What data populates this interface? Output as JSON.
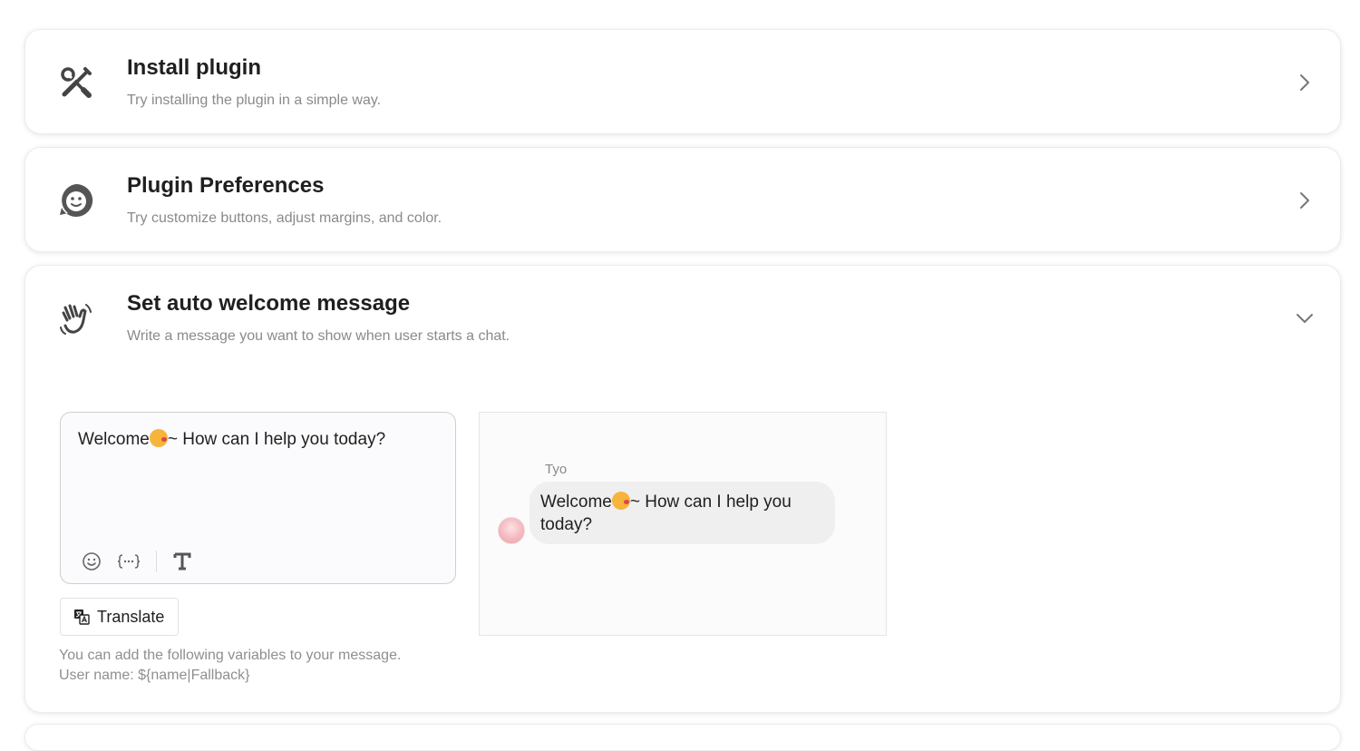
{
  "cards": [
    {
      "title": "Install plugin",
      "description": "Try installing the plugin in a simple way.",
      "icon": "tools-icon",
      "expanded": false
    },
    {
      "title": "Plugin Preferences",
      "description": "Try customize buttons, adjust margins, and color.",
      "icon": "chat-face-icon",
      "expanded": false
    },
    {
      "title": "Set auto welcome message",
      "description": "Write a message you want to show when user starts a chat.",
      "icon": "waving-hand-icon",
      "expanded": true
    }
  ],
  "welcome": {
    "message_before_emoji": "Welcome",
    "message_after_emoji": "~ How can I help you today?",
    "emoji": "kissing-face-emoji",
    "toolbar": [
      "emoji-icon",
      "variable-icon",
      "text-format-icon"
    ],
    "translate_label": "Translate",
    "help_line1": "You can add the following variables to your message.",
    "help_line2": "User name: ${name|Fallback}",
    "preview": {
      "sender_name": "Tyo",
      "message_before_emoji": "Welcome",
      "message_after_emoji": "~ How can I help you today?"
    }
  },
  "colors": {
    "card_border": "#ececec",
    "muted_text": "#8a8a8a",
    "bubble_bg": "#efefef"
  }
}
